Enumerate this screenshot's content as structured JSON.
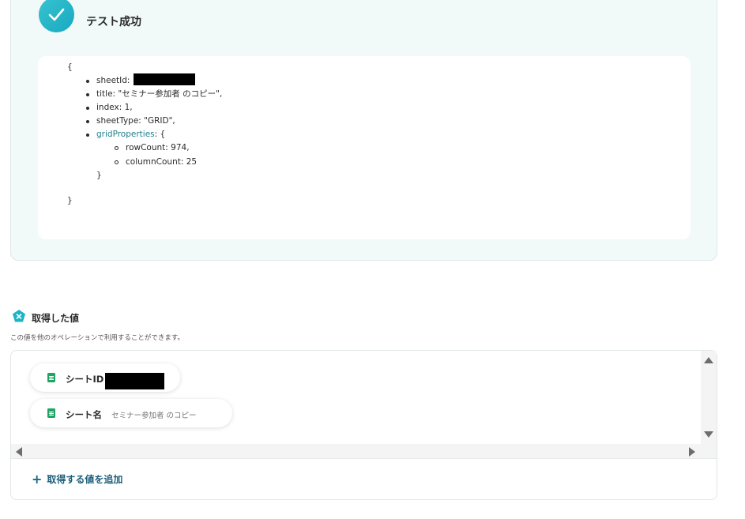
{
  "result": {
    "title": "テスト成功",
    "json_lines": {
      "open_brace": "{",
      "sheet_id_key": "sheetId:",
      "title_line": "title: \"セミナー参加者 のコピー\",",
      "index_line": "index: 1,",
      "sheet_type_line": "sheetType: \"GRID\",",
      "grid_key": "gridProperties",
      "grid_open": ": {",
      "row_count_line": "rowCount: 974,",
      "column_count_line": "columnCount: 25",
      "inner_close": "}",
      "outer_close": "}"
    }
  },
  "acquired": {
    "title": "取得した値",
    "description": "この値を他のオペレーションで利用することができます。",
    "items": [
      {
        "label": "シートID",
        "value": ""
      },
      {
        "label": "シート名",
        "value": "セミナー参加者 のコピー"
      }
    ],
    "add_label": "取得する値を追加"
  },
  "colors": {
    "accent": "#1fb3c8",
    "link": "#1b5d7a",
    "sheets_green": "#1fa463",
    "panel_bg": "#f1f9f9"
  }
}
